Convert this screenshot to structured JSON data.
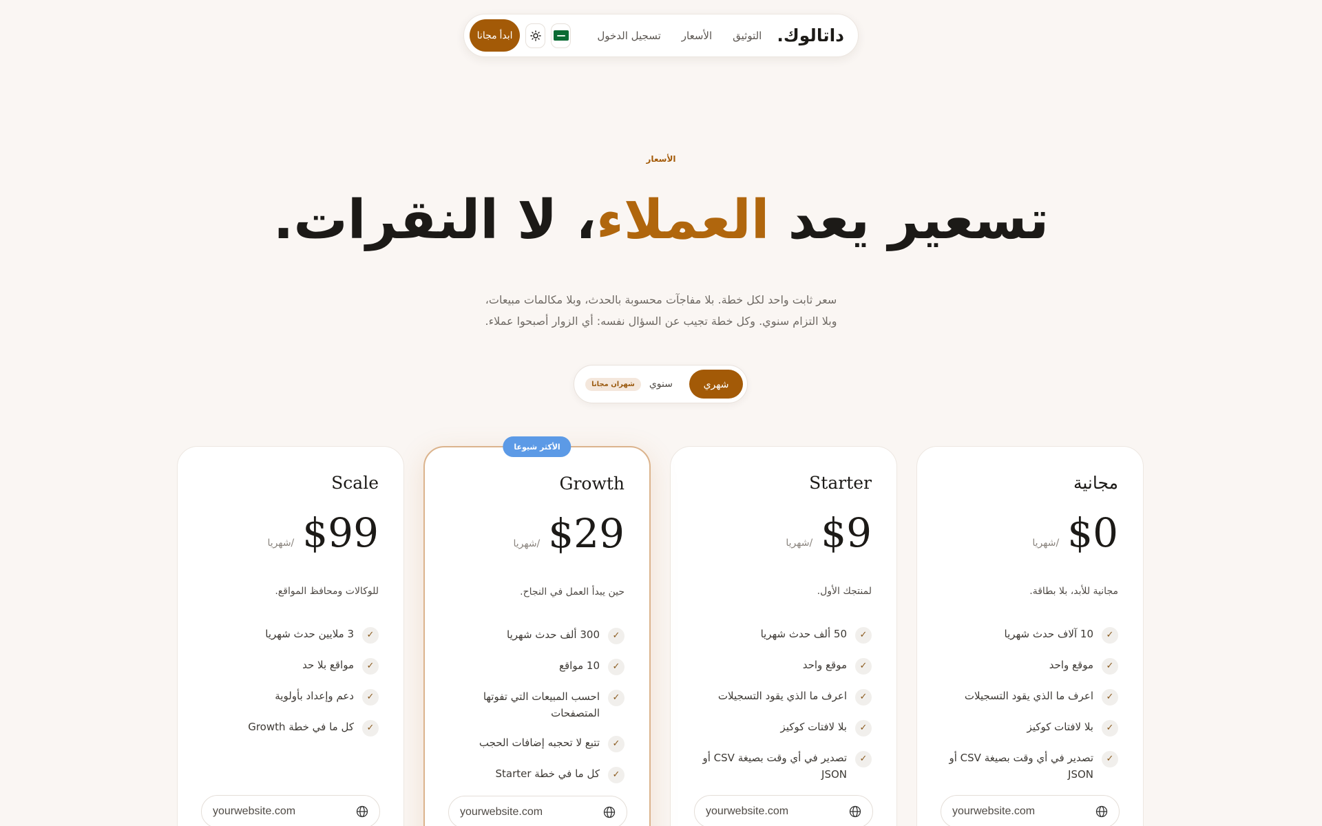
{
  "nav": {
    "logo": "داتالوك.",
    "links": [
      "التوثيق",
      "الأسعار",
      "تسجيل الدخول"
    ],
    "cta": "ابدأ مجانا",
    "language_icon": "saudi-flag-icon",
    "theme_icon": "sun-icon"
  },
  "hero": {
    "eyebrow": "الأسعار",
    "headline_before": "تسعير يعد ",
    "headline_accent": "العملاء",
    "headline_after": "، لا النقرات.",
    "sub_line1": "سعر ثابت واحد لكل خطة. بلا مفاجآت محسوبة بالحدث، وبلا مكالمات مبيعات،",
    "sub_line2": "وبلا التزام سنوي. وكل خطة تجيب عن السؤال نفسه: أي الزوار أصبحوا عملاء."
  },
  "billing": {
    "monthly": "شهري",
    "yearly": "سنوي",
    "yearly_badge": "شهران مجانا",
    "selected": "شهري"
  },
  "plans": [
    {
      "name": "مجانية",
      "price": "$0",
      "period": "/شهريا",
      "desc": "مجانية للأبد، بلا بطاقة.",
      "features": [
        "10 آلاف حدث شهريا",
        "موقع واحد",
        "اعرف ما الذي يقود التسجيلات",
        "بلا لافتات كوكيز",
        "تصدير في أي وقت بصيغة CSV أو JSON"
      ],
      "site_placeholder": "yourwebsite.com"
    },
    {
      "name": "Starter",
      "price": "$9",
      "period": "/شهريا",
      "desc": "لمنتجك الأول.",
      "features": [
        "50 ألف حدث شهريا",
        "موقع واحد",
        "اعرف ما الذي يقود التسجيلات",
        "بلا لافتات كوكيز",
        "تصدير في أي وقت بصيغة CSV أو JSON"
      ],
      "site_placeholder": "yourwebsite.com"
    },
    {
      "name": "Growth",
      "badge": "الأكثر شيوعا",
      "price": "$29",
      "period": "/شهريا",
      "desc": "حين يبدأ العمل في النجاح.",
      "features": [
        "300 ألف حدث شهريا",
        "10 مواقع",
        "احسب المبيعات التي تفوتها المتصفحات",
        "تتبع لا تحجبه إضافات الحجب",
        "كل ما في خطة Starter"
      ],
      "site_placeholder": "yourwebsite.com"
    },
    {
      "name": "Scale",
      "price": "$99",
      "period": "/شهريا",
      "desc": "للوكالات ومحافظ المواقع.",
      "features": [
        "3 ملايين حدث شهريا",
        "مواقع بلا حد",
        "دعم وإعداد بأولوية",
        "كل ما في خطة Growth"
      ],
      "site_placeholder": "yourwebsite.com"
    }
  ],
  "colors": {
    "accent": "#a35a07",
    "background": "#faf6f3",
    "popular_badge": "#5c9ae6"
  }
}
